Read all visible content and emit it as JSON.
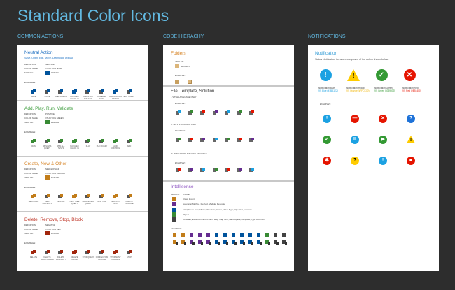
{
  "title": "Standard Color Icons",
  "sections": {
    "common": "COMMON ACTIONS",
    "code": "CODE HIERACHY",
    "notif": "NOTIFICATIONS"
  },
  "labels": {
    "definition": "DEFINITION:",
    "color_name": "COLOR NAME:",
    "swatch": "SWATCH:",
    "examples": "EXAMPLES:",
    "usage": "USAGE"
  },
  "actions": [
    {
      "title": "Neutral Action",
      "subtitle": "Save, Open, Edit, Move, Download, Upload",
      "definition": "NEUTRAL",
      "color_name": "VS ACTION BLUE",
      "hex": "#00539C",
      "title_color": "#1e6fc0",
      "icons": [
        "Save",
        "Move",
        "Open Dialog",
        "Batched Check In",
        "Check Out For Edit",
        "Ordered Test",
        "Association Editor",
        "Edit Query"
      ]
    },
    {
      "title": "Add, Play, Run, Validate",
      "definition": "POSITIVE",
      "color_name": "VS ACTION GREEN",
      "hex": "#388A34",
      "title_color": "#3a9b3a",
      "icons": [
        "Run",
        "Results Query",
        "Run All Tests",
        "Batched Check In",
        "Play",
        "Run Query",
        "Add Control",
        "Add"
      ]
    },
    {
      "title": "Create, New & Other",
      "definition": "NEW & OTHER",
      "color_name": "VS ACTION ORANGE",
      "hex": "#C27D1A",
      "title_color": "#d7862a",
      "icons": [
        "New Build",
        "New Projects",
        "New API",
        "New Tree Query",
        "Create New Query",
        "New Item",
        "New Unit Test",
        "Create Package"
      ]
    },
    {
      "title": "Delete, Remove, Stop, Block",
      "definition": "NEGATIVE",
      "color_name": "VS ACTION RED",
      "hex": "#A1260D",
      "title_color": "#c0392b",
      "icons": [
        "Delete",
        "Delete Relationship",
        "Delete Property",
        "Delete Column",
        "Stop Query",
        "Connection Offline",
        "Stop Many Threads",
        "Stop"
      ]
    }
  ],
  "code": {
    "folders": {
      "title": "Folders",
      "hex": "#DCB67A"
    },
    "file": {
      "title": "File, Template, Solution",
      "groups": [
        "I.  WITH LANGUAGE ONLY",
        "II.  WITH PLATFORM ONLY",
        "III.  WITH PRODUCT AND LANGUAGE"
      ]
    },
    "intellisense": {
      "title": "Intellisense",
      "rows": [
        {
          "color": "#C27D1A",
          "usage": "Class, Event"
        },
        {
          "color": "#652D90",
          "usage": "Extension Method, Method, Module, Delegate"
        },
        {
          "color": "#00539C",
          "usage": "Field, Enum Item, Macro, Structure, Union, Value Type, Operator, Interface"
        },
        {
          "color": "#388A34",
          "usage": "Object"
        },
        {
          "color": "#424242",
          "usage": "Constant, Exception, Enum Item, Map, Map Item, Namespace, Template, Type Definition"
        }
      ]
    }
  },
  "notification": {
    "title": "Notification",
    "description": "Status Notification icons are composed of the colors shown below:",
    "colors": [
      {
        "name": "Notification Blue",
        "value": "VS Blue (#1BA1E2)",
        "hex": "#1BA1E2",
        "glyph": "!"
      },
      {
        "name": "Notification Yellow",
        "value": "VS Orange (#FFCC00)",
        "hex": "#FFCC00",
        "glyph": "!"
      },
      {
        "name": "Notification Green",
        "value": "VS Green (#339933)",
        "hex": "#339933",
        "glyph": "✓"
      },
      {
        "name": "Notification Red",
        "value": "VS Red (#E51400)",
        "hex": "#E51400",
        "glyph": "✕"
      }
    ],
    "examples": [
      {
        "hex": "#1BA1E2",
        "glyph": "!"
      },
      {
        "hex": "#E51400",
        "glyph": "—"
      },
      {
        "hex": "#E51400",
        "glyph": "✕"
      },
      {
        "hex": "#1e72d8",
        "glyph": "?"
      },
      {
        "hex": "#339933",
        "glyph": "✓"
      },
      {
        "hex": "#1BA1E2",
        "glyph": "II"
      },
      {
        "hex": "#339933",
        "glyph": "▶"
      },
      {
        "hex": "tri",
        "glyph": "!"
      },
      {
        "hex": "#E51400",
        "glyph": "✱"
      },
      {
        "hex": "#FFCC00",
        "glyph": "?"
      },
      {
        "hex": "#1BA1E2",
        "glyph": "!"
      },
      {
        "hex": "#E51400",
        "glyph": "■"
      }
    ]
  }
}
